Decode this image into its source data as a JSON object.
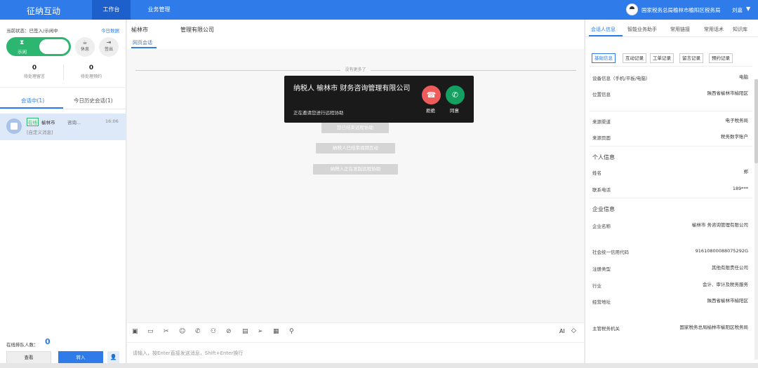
{
  "topbar": {
    "app_title": "征纳互动",
    "nav": [
      "工作台",
      "业务管理"
    ],
    "org": "国家税务总局榆林市榆阳区税务局",
    "user": "刘嘉",
    "accent_color": "#2f7bea"
  },
  "left": {
    "status": "当前状态：已签入/示闲中",
    "today_data": "今日数据",
    "toggle_label": "示闲",
    "rest_label": "休息",
    "logout_label": "签出",
    "pending_msg_count": "0",
    "pending_msg_label": "待处理留言",
    "pending_book_count": "0",
    "pending_book_label": "待处理预约",
    "tabs": [
      "会话中(1)",
      "今日历史会话(1)"
    ],
    "conversation": {
      "online": "在线",
      "name": "榆林市",
      "snippet": "咨询...",
      "time": "16:06",
      "custom": "[自定义消息]"
    },
    "queue_label": "在线排队人数：",
    "queue_count": "0",
    "query_label": "查看",
    "transfer_label": "转入"
  },
  "center": {
    "contact_name": "榆林市",
    "contact_company": "管理有限公司",
    "tab": "网页会话",
    "no_more": "没有更多了",
    "system_messages": [
      "您已结束远程协助",
      "纳税人已结束视频互动",
      "纳税人正在发起远程协助"
    ],
    "ai_label": "AI",
    "input_placeholder": "请输入，按Enter直接发送消息，Shift+Enter换行"
  },
  "popup": {
    "title": "纳税人 榆林市 财务咨询管理有限公司",
    "subtitle": "正在邀请您进行远程协助",
    "reject_label": "拒绝",
    "accept_label": "同意"
  },
  "right": {
    "tabs": [
      "会话人信息",
      "智能业务助手",
      "常用链接",
      "常用话术",
      "知识库"
    ],
    "subtabs": [
      "基础信息",
      "互动记录",
      "工单记录",
      "留言记录",
      "预约记录"
    ],
    "fields": [
      {
        "label": "设备信息（手机/平板/电脑）",
        "value": "电脑"
      },
      {
        "label": "位置信息",
        "value": "陕西省榆林市榆阳区"
      },
      {
        "label": "来源渠道",
        "value": "电子税务局"
      },
      {
        "label": "来源页面",
        "value": "税务数字账户"
      }
    ],
    "section_personal": "个人信息",
    "personal": [
      {
        "label": "姓名",
        "value": "郑"
      },
      {
        "label": "联系电话",
        "value": "189***"
      }
    ],
    "section_company": "企业信息",
    "company": [
      {
        "label": "企业名称",
        "value": "榆林市 务咨询管理有限公司"
      },
      {
        "label": "社会统一信用代码",
        "value": "91610800088075292G"
      },
      {
        "label": "注册类型",
        "value": "其他有限责任公司"
      },
      {
        "label": "行业",
        "value": "会计、审计及税务服务"
      },
      {
        "label": "经营地址",
        "value": "陕西省榆林市榆阳区"
      },
      {
        "label": "主管税务机关",
        "value": "国家税务总局榆林市榆阳区税务局"
      }
    ]
  }
}
